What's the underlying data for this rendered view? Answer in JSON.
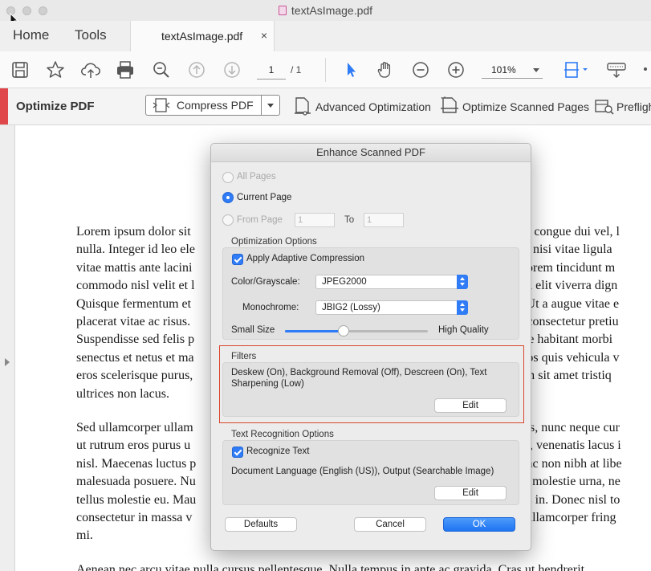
{
  "window": {
    "title": "textAsImage.pdf"
  },
  "tabs": {
    "home": "Home",
    "tools": "Tools",
    "document": "textAsImage.pdf",
    "close": "×"
  },
  "toolbar": {
    "page_current": "1",
    "page_total": "/ 1",
    "zoom": "101%"
  },
  "optimize_bar": {
    "title": "Optimize PDF",
    "compress_label": "Compress PDF",
    "advanced_label": "Advanced Optimization",
    "scanned_label": "Optimize Scanned Pages",
    "preflight_label": "Preflight"
  },
  "document": {
    "paragraphs": [
      [
        "Lorem ipsum dolor sit",
        "nulla. Integer id leo ele",
        "vitae mattis ante lacini",
        "commodo nisl velit et l",
        "Quisque fermentum et",
        "placerat vitae ac risus.",
        "Suspendisse sed felis p",
        "senectus et netus et ma",
        "eros scelerisque purus,",
        "ultrices non lacus."
      ],
      [
        "Sed ullamcorper ullam",
        "ut rutrum eros purus u",
        "nisl. Maecenas luctus p",
        "malesuada posuere. Nu",
        "tellus molestie eu. Mau",
        "consectetur in massa v",
        "mi."
      ],
      [
        "Aenean nec arcu vitae nulla cursus pellentesque. Nulla tempus in ante ac gravida. Cras ut hendrerit"
      ]
    ],
    "right_lines_p1": [
      "cus, congue dui vel, l",
      "etra nisi vitae ligula",
      "la lorem tincidunt m",
      "ris a elit viverra dign",
      "ta. Ut a augue vitae e",
      "ut, consectetur pretiu",
      "sque habitant morbi",
      ", eros quis vehicula v",
      "trum sit amet tristiq"
    ],
    "right_lines_p2": [
      "rices, nunc neque cur",
      "giat, venenatis lacus i",
      "Nunc non nibh at libe",
      "que molestie urna, ne",
      "attis in. Donec nisl to",
      "ue ullamcorper fring"
    ]
  },
  "dialog": {
    "title": "Enhance Scanned PDF",
    "all_pages": "All Pages",
    "current_page": "Current Page",
    "from_page": "From Page",
    "from_value": "1",
    "to_label": "To",
    "to_value": "1",
    "optimization_options": "Optimization Options",
    "adaptive_compression": "Apply Adaptive Compression",
    "color_label": "Color/Grayscale:",
    "color_value": "JPEG2000",
    "mono_label": "Monochrome:",
    "mono_value": "JBIG2 (Lossy)",
    "small_size": "Small Size",
    "high_quality": "High Quality",
    "quality_level": 0.41,
    "filters_title": "Filters",
    "filters_desc_1": "Deskew (On), Background Removal (Off), Descreen (On), Text",
    "filters_desc_2": "Sharpening (Low)",
    "edit_label": "Edit",
    "text_recognition": "Text Recognition Options",
    "recognize_text": "Recognize Text",
    "ocr_desc": "Document Language (English (US)), Output (Searchable Image)",
    "defaults": "Defaults",
    "cancel": "Cancel",
    "ok": "OK"
  },
  "colors": {
    "accent": "#2f7cf6",
    "highlight": "#d9462b",
    "optimize_strip": "#e0474b"
  }
}
